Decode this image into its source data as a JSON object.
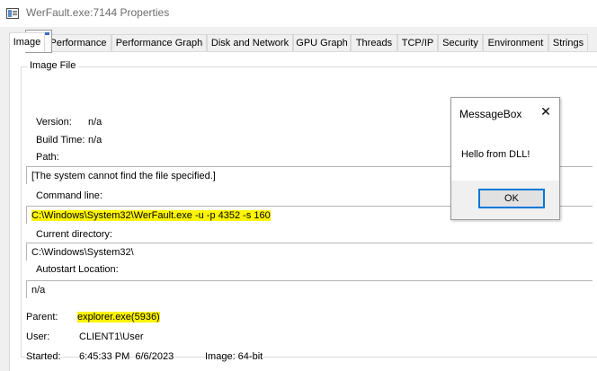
{
  "window": {
    "title": "WerFault.exe:7144 Properties",
    "icon": "process-properties-icon"
  },
  "tabs": [
    "Image",
    "Performance",
    "Performance Graph",
    "Disk and Network",
    "GPU Graph",
    "Threads",
    "TCP/IP",
    "Security",
    "Environment",
    "Strings"
  ],
  "active_tab": "Image",
  "image_file": {
    "legend": "Image File",
    "icon": "exe-file-icon",
    "version_label": "Version:",
    "version_value": "n/a",
    "build_time_label": "Build Time:",
    "build_time_value": "n/a",
    "path_label": "Path:",
    "path_value": "[The system cannot find the file specified.]",
    "command_line_label": "Command line:",
    "command_line_value": "C:\\Windows\\System32\\WerFault.exe -u -p 4352 -s 160",
    "current_directory_label": "Current directory:",
    "current_directory_value": "C:\\Windows\\System32\\",
    "autostart_label": "Autostart Location:",
    "autostart_value": "n/a"
  },
  "process": {
    "parent_label": "Parent:",
    "parent_value": "explorer.exe(5936)",
    "user_label": "User:",
    "user_value": "CLIENT1\\User",
    "started_label": "Started:",
    "started_value": "6:45:33 PM  6/6/2023",
    "image_bits": "Image: 64-bit"
  },
  "messagebox": {
    "title": "MessageBox",
    "close_glyph": "✕",
    "message": "Hello from DLL!",
    "ok_label": "OK"
  },
  "colors": {
    "highlight": "#fcf400",
    "button_focus": "#0078d7"
  }
}
